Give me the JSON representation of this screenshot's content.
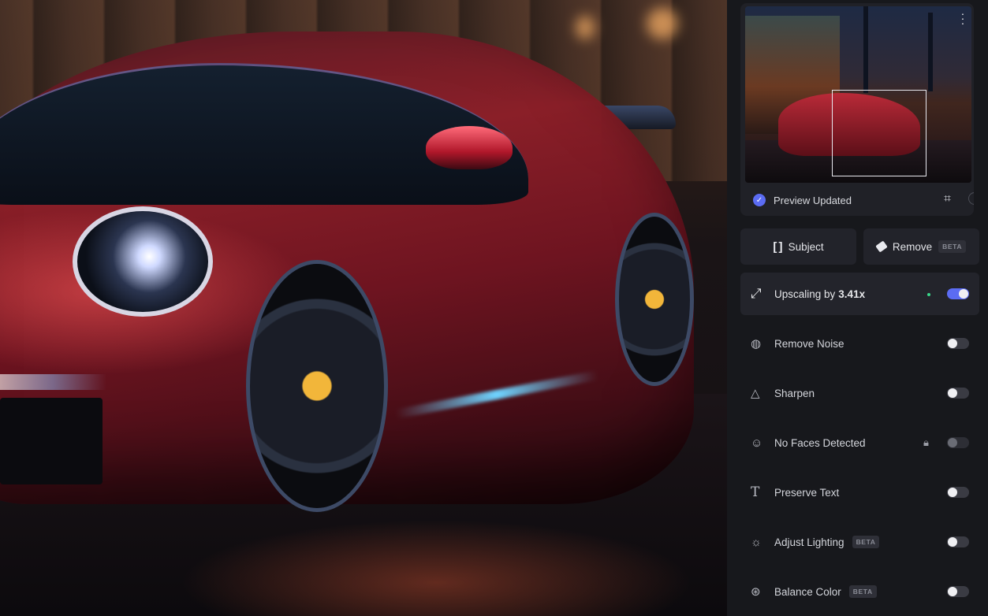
{
  "preview": {
    "status_label": "Preview Updated",
    "check_icon": "check-circle-icon",
    "crop_icon": "crop-icon",
    "face_icon": "face-icon",
    "more_icon": "more-vertical-icon"
  },
  "tools": {
    "subject_label": "Subject",
    "remove_label": "Remove",
    "remove_badge": "BETA"
  },
  "upscale": {
    "label": "Upscaling by",
    "value": "3.41x",
    "enabled": true
  },
  "options": [
    {
      "label": "Remove Noise",
      "icon": "noise-icon",
      "enabled": false
    },
    {
      "label": "Sharpen",
      "icon": "triangle-icon",
      "enabled": false
    },
    {
      "label": "No Faces Detected",
      "icon": "face-icon",
      "enabled": false,
      "locked": true
    },
    {
      "label": "Preserve Text",
      "icon": "text-icon",
      "enabled": false
    },
    {
      "label": "Adjust Lighting",
      "icon": "sun-icon",
      "enabled": false,
      "badge": "BETA"
    },
    {
      "label": "Balance Color",
      "icon": "color-balance-icon",
      "enabled": false,
      "badge": "BETA"
    }
  ],
  "colors": {
    "accent": "#5b6cf3",
    "panel_bg": "#17181c",
    "card_bg": "#23242b",
    "status_dot": "#39d98a"
  }
}
